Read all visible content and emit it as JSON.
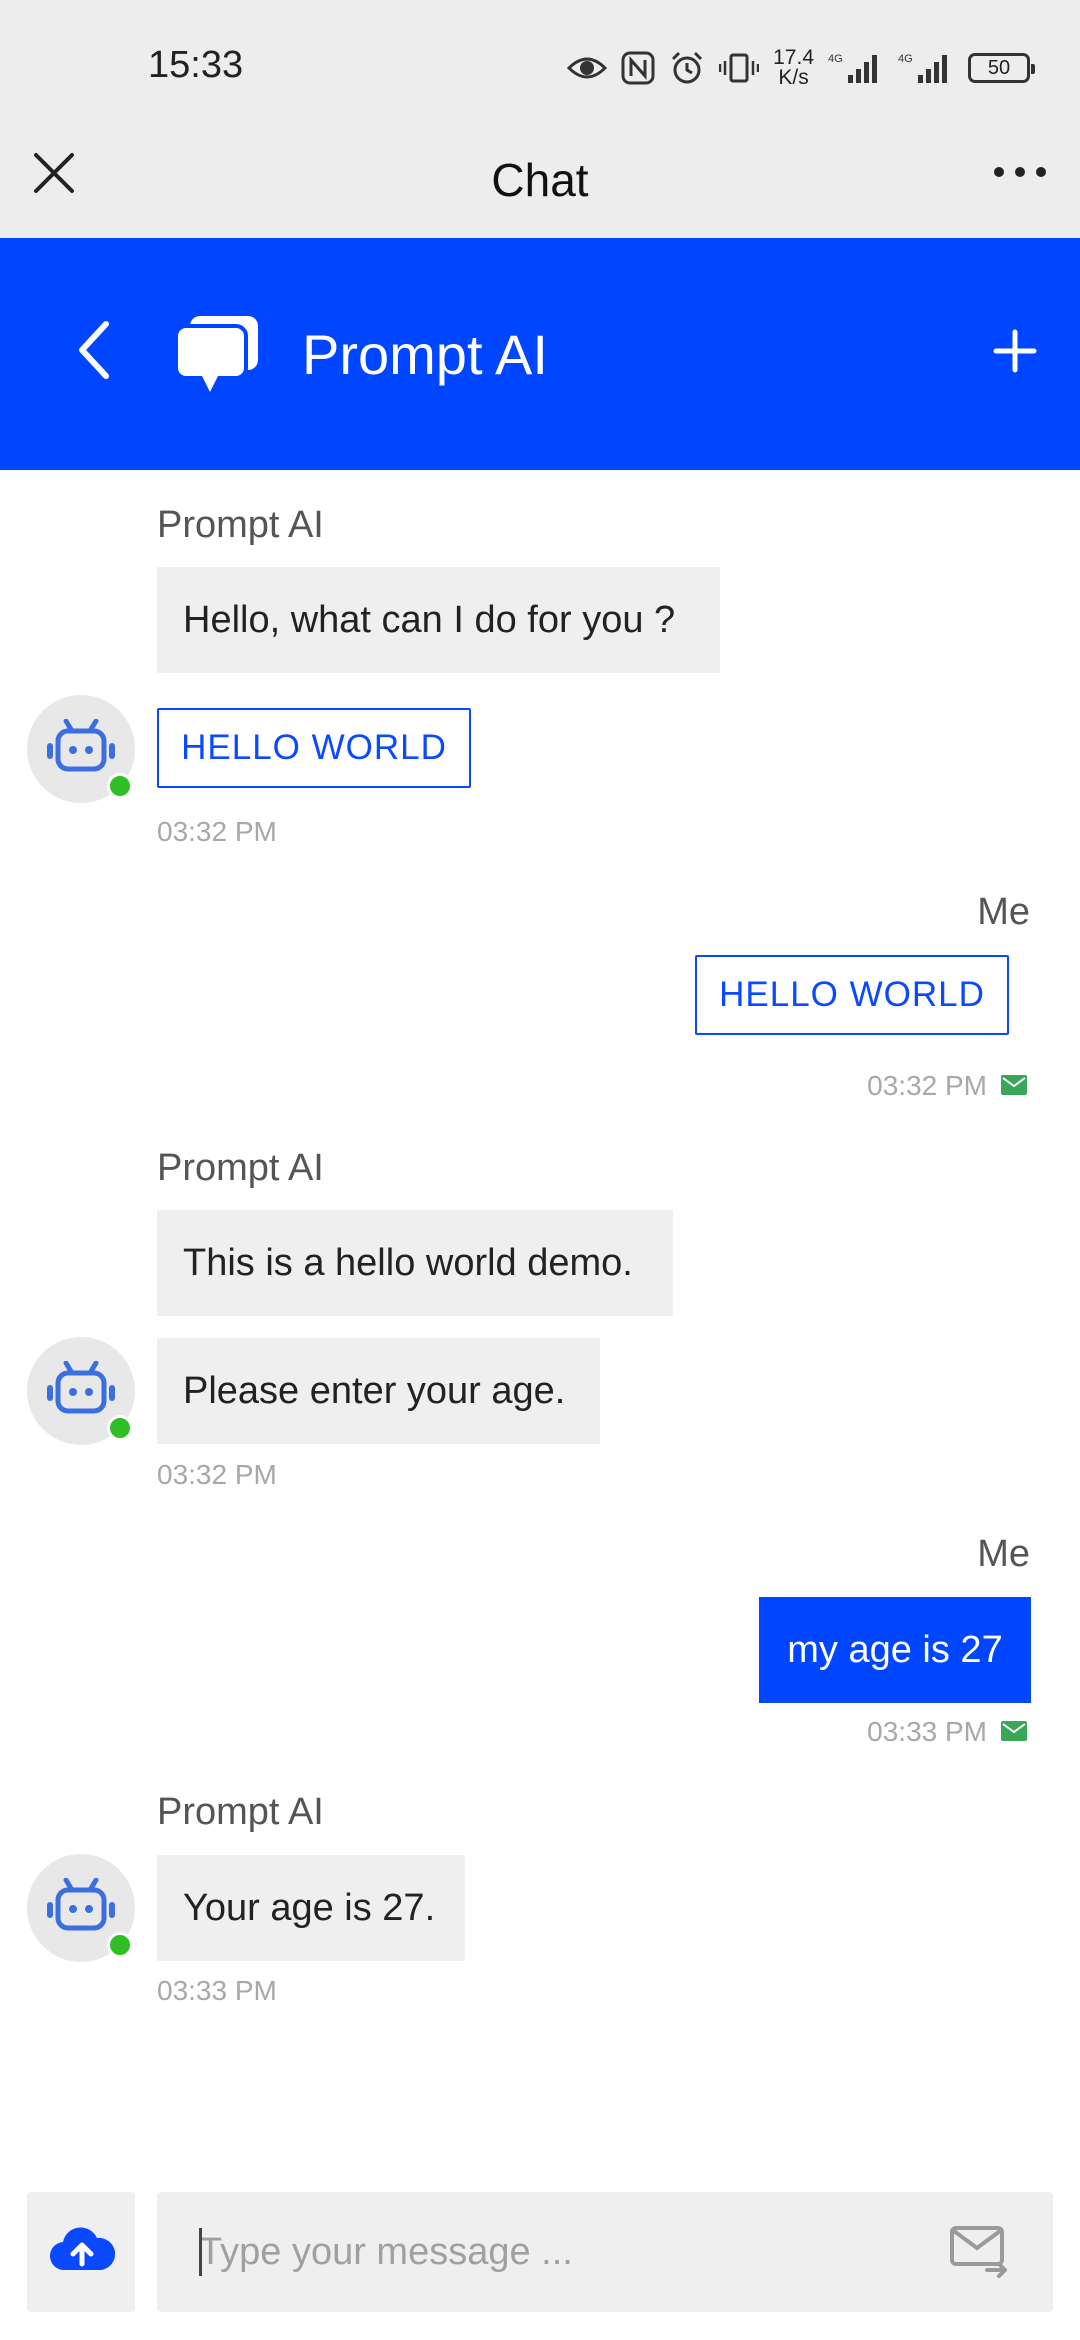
{
  "status_bar": {
    "time": "15:33",
    "net_speed_value": "17.4",
    "net_speed_unit": "K/s",
    "signal_1": "4G",
    "signal_2": "4G",
    "battery": "50",
    "icons": [
      "eye-icon",
      "nfc-icon",
      "alarm-icon",
      "vibrate-icon",
      "signal-icon",
      "battery-icon"
    ]
  },
  "title_bar": {
    "title": "Chat"
  },
  "header": {
    "title": "Prompt AI",
    "accent_color": "#0045ff"
  },
  "messages": [
    {
      "sender": "Prompt AI",
      "side": "left",
      "bubbles": [
        "Hello, what can I do for you ?"
      ],
      "chip": "HELLO WORLD",
      "time": "03:32 PM"
    },
    {
      "sender": "Me",
      "side": "right",
      "chip": "HELLO WORLD",
      "time": "03:32 PM"
    },
    {
      "sender": "Prompt AI",
      "side": "left",
      "bubbles": [
        "This is a hello world demo.",
        "Please enter your age."
      ],
      "time": "03:32 PM"
    },
    {
      "sender": "Me",
      "side": "right",
      "bubbles": [
        "my age is 27"
      ],
      "time": "03:33 PM"
    },
    {
      "sender": "Prompt AI",
      "side": "left",
      "bubbles": [
        "Your age is 27."
      ],
      "time": "03:33 PM"
    }
  ],
  "input": {
    "placeholder": "Type your message ...",
    "value": ""
  },
  "colors": {
    "online": "#2fbf25",
    "sent": "#3aa757",
    "bot_icon": "#3b6fe0"
  }
}
